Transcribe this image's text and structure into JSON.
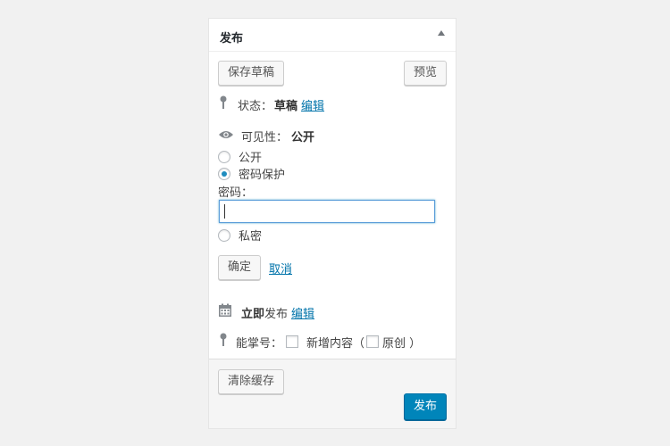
{
  "panel": {
    "title": "发布",
    "save_draft_label": "保存草稿",
    "preview_label": "预览",
    "status": {
      "label": "状态：",
      "value": "草稿",
      "edit_link": "编辑"
    },
    "visibility": {
      "label": "可见性：",
      "value": "公开",
      "options": [
        {
          "label": "公开",
          "checked": false
        },
        {
          "label": "密码保护",
          "checked": true
        },
        {
          "label": "私密",
          "checked": false
        }
      ],
      "password_label": "密码：",
      "password_value": "",
      "ok_label": "确定",
      "cancel_label": "取消"
    },
    "schedule": {
      "label_strong": "立即",
      "label_rest": "发布",
      "edit_link": "编辑"
    },
    "extras": {
      "label": "能掌号：",
      "new_content_label": "新增内容（",
      "original_label": "原创 ）"
    },
    "footer": {
      "clear_cache_label": "清除缓存",
      "publish_label": "发布"
    }
  },
  "colors": {
    "primary": "#0085ba",
    "link": "#0073aa",
    "icon": "#82878c"
  }
}
